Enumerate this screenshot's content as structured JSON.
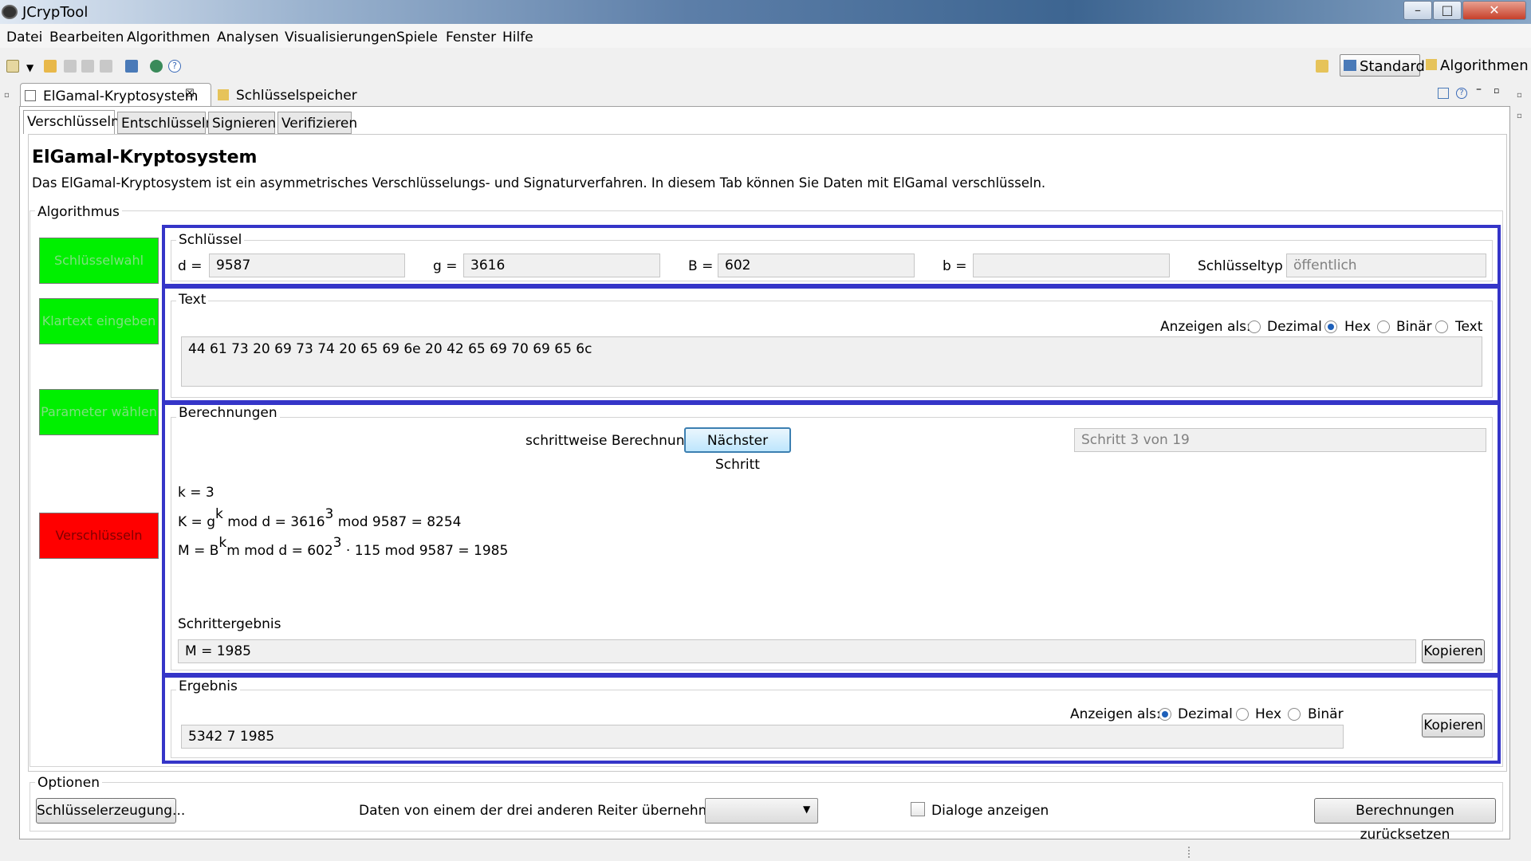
{
  "window": {
    "title": "JCrypTool",
    "minimize": "–",
    "maximize": "□",
    "close": "✕"
  },
  "menu": [
    "Datei",
    "Bearbeiten",
    "Algorithmen",
    "Analysen",
    "Visualisierungen",
    "Spiele",
    "Fenster",
    "Hilfe"
  ],
  "perspectives": {
    "standard": "Standard",
    "algorithms": "Algorithmen"
  },
  "editor_tabs": {
    "main": "ElGamal-Kryptosystem",
    "main_close": "☒",
    "keystore": "Schlüsselspeicher"
  },
  "subtabs": [
    "Verschlüsseln",
    "Entschlüsseln",
    "Signieren",
    "Verifizieren"
  ],
  "header": {
    "title": "ElGamal-Kryptosystem",
    "description": "Das ElGamal-Kryptosystem ist ein asymmetrisches Verschlüsselungs- und Signaturverfahren. In diesem Tab können Sie Daten mit ElGamal verschlüsseln."
  },
  "algorithm_group": "Algorithmus",
  "steps": [
    "Schlüsselwahl",
    "Klartext eingeben",
    "Parameter wählen",
    "Verschlüsseln"
  ],
  "key": {
    "group": "Schlüssel",
    "d_label": "d =",
    "d_value": "9587",
    "g_label": "g =",
    "g_value": "3616",
    "B_label": "B =",
    "B_value": "602",
    "b_label": "b =",
    "b_value": "",
    "type_label": "Schlüsseltyp :",
    "type_value": "öffentlich"
  },
  "text": {
    "group": "Text",
    "display_label": "Anzeigen als:",
    "options": [
      "Dezimal",
      "Hex",
      "Binär",
      "Text"
    ],
    "selected": "Hex",
    "value": "44 61 73 20 69 73 74 20 65 69 6e 20 42 65 69 70 69 65 6c"
  },
  "calc": {
    "group": "Berechnungen",
    "stepwise_label": "schrittweise Berechnung:",
    "next_button": "Nächster Schritt",
    "step_status": "Schritt 3 von 19",
    "line1": "k = 3",
    "line2_a": "K = g",
    "line2_sup1": "k",
    "line2_b": " mod d = 3616",
    "line2_sup2": "3",
    "line2_c": " mod 9587 = 8254",
    "line3_a": "M = B",
    "line3_sup1": "k",
    "line3_b": "m mod d = 602",
    "line3_sup2": "3",
    "line3_c": " · 115 mod 9587 = 1985",
    "result_label": "Schrittergebnis",
    "result_value": "M = 1985",
    "copy_button": "Kopieren"
  },
  "result": {
    "group": "Ergebnis",
    "display_label": "Anzeigen als:",
    "options": [
      "Dezimal",
      "Hex",
      "Binär"
    ],
    "selected": "Dezimal",
    "value": "5342 7 1985",
    "copy_button": "Kopieren"
  },
  "options": {
    "group": "Optionen",
    "keygen_button": "Schlüsselerzeugung...",
    "import_label": "Daten von einem der drei anderen Reiter übernehmen:",
    "import_value": "",
    "dialogs_label": "Dialoge anzeigen",
    "reset_button": "Berechnungen zurücksetzen"
  }
}
